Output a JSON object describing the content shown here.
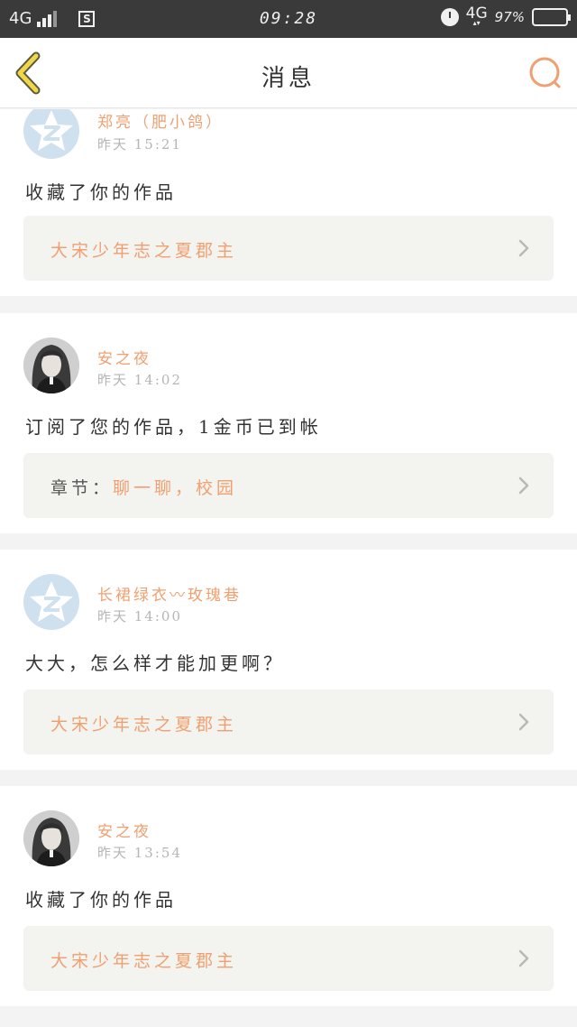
{
  "status_bar": {
    "network_left": "4G",
    "time": "09:28",
    "network_right": "4G",
    "network_arrows": "▴▾",
    "battery_percent": "97%",
    "battery_level": 0.97
  },
  "nav": {
    "title": "消息",
    "back_icon": "chevron-left-icon",
    "search_icon": "search-icon",
    "accent_color": "#f0a070"
  },
  "messages": [
    {
      "avatar": "qq-default-avatar",
      "name": "郑亮（肥小鸽）",
      "time": "昨天 15:21",
      "text": "收藏了你的作品",
      "work_prefix": "",
      "work_title": "大宋少年志之夏郡主"
    },
    {
      "avatar": "user-photo-avatar",
      "name": "安之夜",
      "time": "昨天 14:02",
      "text": "订阅了您的作品，1金币已到帐",
      "work_prefix": "章节：",
      "work_title": "聊一聊，校园"
    },
    {
      "avatar": "qq-default-avatar",
      "name": "长裙绿衣〰玫瑰巷",
      "time": "昨天 14:00",
      "text": "大大，怎么样才能加更啊？",
      "work_prefix": "",
      "work_title": "大宋少年志之夏郡主"
    },
    {
      "avatar": "user-photo-avatar",
      "name": "安之夜",
      "time": "昨天 13:54",
      "text": "收藏了你的作品",
      "work_prefix": "",
      "work_title": "大宋少年志之夏郡主"
    }
  ]
}
